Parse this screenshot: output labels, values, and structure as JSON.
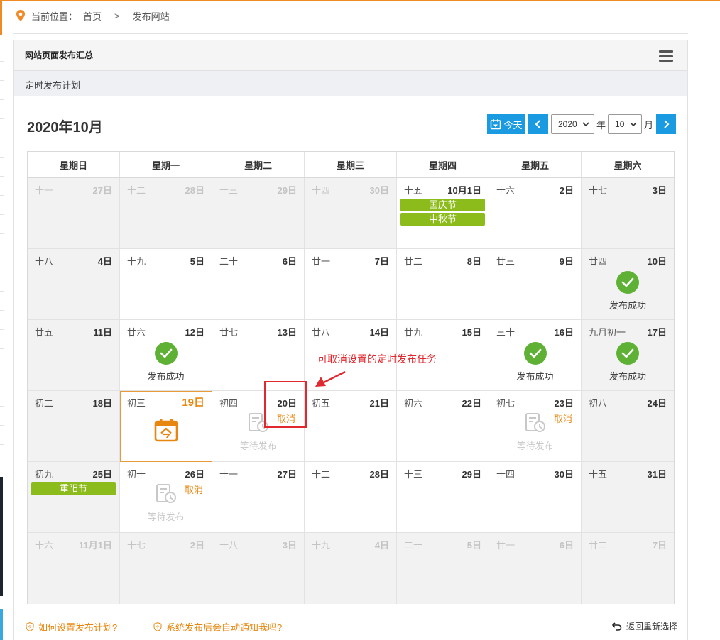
{
  "breadcrumb": {
    "prefix": "当前位置：",
    "home": "首页",
    "separator": ">",
    "current": "发布网站"
  },
  "panel": {
    "title": "网站页面发布汇总",
    "subtitle": "定时发布计划"
  },
  "calendar": {
    "month_title": "2020年10月",
    "today_label": "今天",
    "year_value": "2020",
    "year_unit": "年",
    "month_value": "10",
    "month_unit": "月",
    "weekdays": [
      "星期日",
      "星期一",
      "星期二",
      "星期三",
      "星期四",
      "星期五",
      "星期六"
    ],
    "status_success": "发布成功",
    "status_waiting": "等待发布",
    "cancel_label": "取消",
    "rows": [
      [
        {
          "lunar": "十一",
          "day": "27日",
          "other": true
        },
        {
          "lunar": "十二",
          "day": "28日",
          "other": true
        },
        {
          "lunar": "十三",
          "day": "29日",
          "other": true
        },
        {
          "lunar": "十四",
          "day": "30日",
          "other": true
        },
        {
          "lunar": "十五",
          "day": "10月1日",
          "holidays": [
            "国庆节",
            "中秋节"
          ]
        },
        {
          "lunar": "十六",
          "day": "2日"
        },
        {
          "lunar": "十七",
          "day": "3日"
        }
      ],
      [
        {
          "lunar": "十八",
          "day": "4日"
        },
        {
          "lunar": "十九",
          "day": "5日"
        },
        {
          "lunar": "二十",
          "day": "6日"
        },
        {
          "lunar": "廿一",
          "day": "7日"
        },
        {
          "lunar": "廿二",
          "day": "8日"
        },
        {
          "lunar": "廿三",
          "day": "9日"
        },
        {
          "lunar": "廿四",
          "day": "10日",
          "status": "success"
        }
      ],
      [
        {
          "lunar": "廿五",
          "day": "11日"
        },
        {
          "lunar": "廿六",
          "day": "12日",
          "status": "success"
        },
        {
          "lunar": "廿七",
          "day": "13日"
        },
        {
          "lunar": "廿八",
          "day": "14日"
        },
        {
          "lunar": "廿九",
          "day": "15日"
        },
        {
          "lunar": "三十",
          "day": "16日",
          "status": "success"
        },
        {
          "lunar": "九月初一",
          "day": "17日",
          "status": "success"
        }
      ],
      [
        {
          "lunar": "初二",
          "day": "18日"
        },
        {
          "lunar": "初三",
          "day": "19日",
          "today": true
        },
        {
          "lunar": "初四",
          "day": "20日",
          "status": "waiting",
          "cancel": true
        },
        {
          "lunar": "初五",
          "day": "21日"
        },
        {
          "lunar": "初六",
          "day": "22日"
        },
        {
          "lunar": "初七",
          "day": "23日",
          "status": "waiting",
          "cancel": true
        },
        {
          "lunar": "初八",
          "day": "24日"
        }
      ],
      [
        {
          "lunar": "初九",
          "day": "25日",
          "holidays": [
            "重阳节"
          ]
        },
        {
          "lunar": "初十",
          "day": "26日",
          "status": "waiting",
          "cancel": true
        },
        {
          "lunar": "十一",
          "day": "27日"
        },
        {
          "lunar": "十二",
          "day": "28日"
        },
        {
          "lunar": "十三",
          "day": "29日"
        },
        {
          "lunar": "十四",
          "day": "30日"
        },
        {
          "lunar": "十五",
          "day": "31日"
        }
      ],
      [
        {
          "lunar": "十六",
          "day": "11月1日",
          "other": true
        },
        {
          "lunar": "十七",
          "day": "2日",
          "other": true
        },
        {
          "lunar": "十八",
          "day": "3日",
          "other": true
        },
        {
          "lunar": "十九",
          "day": "4日",
          "other": true
        },
        {
          "lunar": "二十",
          "day": "5日",
          "other": true
        },
        {
          "lunar": "廿一",
          "day": "6日",
          "other": true
        },
        {
          "lunar": "廿二",
          "day": "7日",
          "other": true
        }
      ]
    ]
  },
  "annotation": {
    "text": "可取消设置的定时发布任务"
  },
  "footer": {
    "help1": "如何设置发布计划?",
    "help2": "系统发布后会自动通知我吗?",
    "back": "返回重新选择"
  },
  "colors": {
    "accent_orange": "#e8870f",
    "primary_blue": "#1a9ae0",
    "holiday_green": "#8cbc1b",
    "success_green": "#5eb134",
    "annotation_red": "#e0282e"
  }
}
